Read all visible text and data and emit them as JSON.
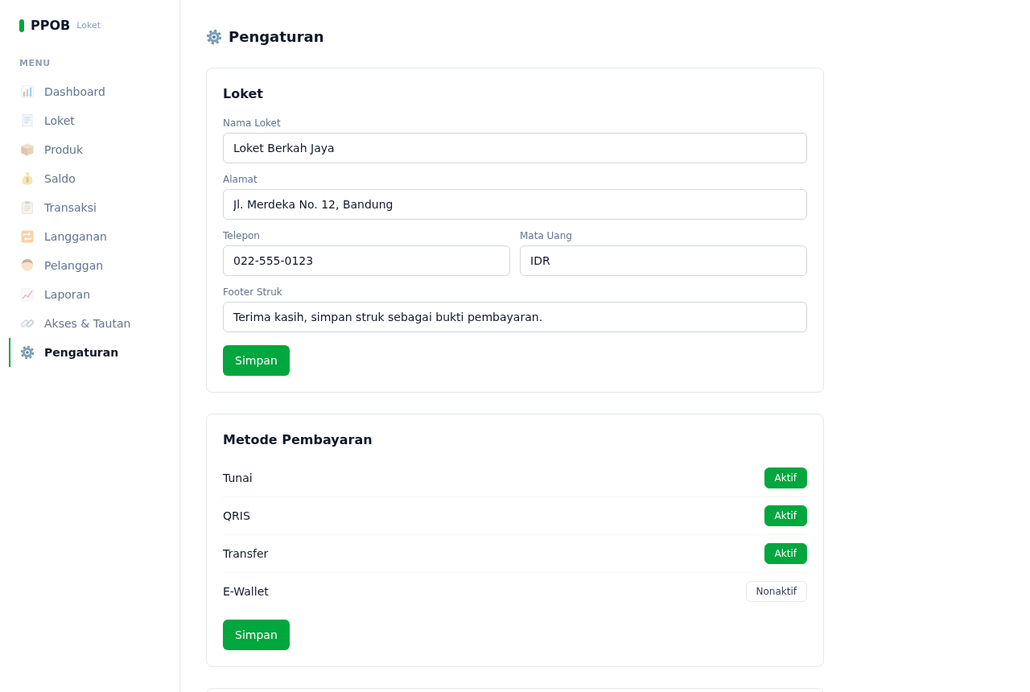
{
  "sidebar": {
    "brand": "PPOB",
    "brand_sub": "Loket",
    "section_label": "MENU",
    "items": [
      {
        "label": "Dashboard",
        "selected": false
      },
      {
        "label": "Loket",
        "selected": false
      },
      {
        "label": "Produk",
        "selected": false
      },
      {
        "label": "Saldo",
        "selected": false
      },
      {
        "label": "Transaksi",
        "selected": false
      },
      {
        "label": "Langganan",
        "selected": false
      },
      {
        "label": "Pelanggan",
        "selected": false
      },
      {
        "label": "Laporan",
        "selected": false
      },
      {
        "label": "Akses & Tautan",
        "selected": false
      },
      {
        "label": "Pengaturan",
        "selected": true
      }
    ]
  },
  "page": {
    "title": "Pengaturan"
  },
  "loket_card": {
    "title": "Loket",
    "rows": [
      [
        {
          "label": "Nama Loket",
          "value": "Loket Berkah Jaya"
        }
      ],
      [
        {
          "label": "Alamat",
          "value": "Jl. Merdeka No. 12, Bandung"
        }
      ],
      [
        {
          "label": "Telepon",
          "value": "022-555-0123"
        },
        {
          "label": "Mata Uang",
          "value": "IDR"
        }
      ],
      [
        {
          "label": "Footer Struk",
          "value": "Terima kasih, simpan struk sebagai bukti pembayaran."
        }
      ]
    ],
    "button": "Simpan"
  },
  "payment_card": {
    "title": "Metode Pembayaran",
    "methods": [
      {
        "name": "Tunai",
        "status": "Aktif",
        "active": true
      },
      {
        "name": "QRIS",
        "status": "Aktif",
        "active": true
      },
      {
        "name": "Transfer",
        "status": "Aktif",
        "active": true
      },
      {
        "name": "E-Wallet",
        "status": "Nonaktif",
        "active": false
      }
    ],
    "button": "Simpan"
  }
}
